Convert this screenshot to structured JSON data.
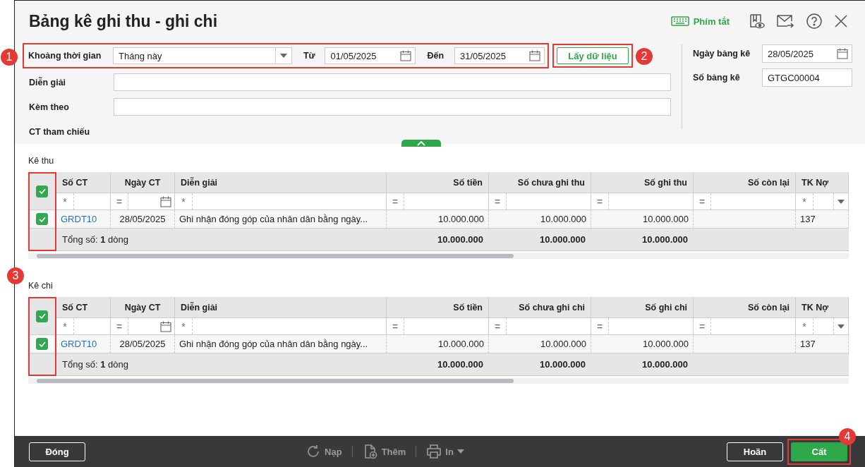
{
  "window": {
    "title": "Bảng kê ghi thu - ghi chi",
    "shortcut": "Phím tắt"
  },
  "filter": {
    "callout": "1",
    "period_label": "Khoảng thời gian",
    "period": "Tháng này",
    "from_label": "Từ",
    "from": "01/05/2025",
    "to_label": "Đến",
    "to": "31/05/2025"
  },
  "fetch_button": {
    "label": "Lấy dữ liệu",
    "callout": "2"
  },
  "fields": [
    {
      "label": "Diễn giải",
      "kind": "input"
    },
    {
      "label": "Kèm theo",
      "kind": "input"
    },
    {
      "label": "CT tham chiếu",
      "kind": "label"
    }
  ],
  "side_fields": [
    {
      "label": "Ngày bảng kê",
      "value": "28/05/2025",
      "kind": "date"
    },
    {
      "label": "Số bảng kê",
      "value": "GTGC00004",
      "kind": "text"
    }
  ],
  "tables_callout": "3",
  "sections": [
    {
      "title": "Kê thu",
      "all_checked": true,
      "columns": [
        {
          "label": "Số CT",
          "kind": "link",
          "op": "*"
        },
        {
          "label": "Ngày CT",
          "kind": "date",
          "op": "="
        },
        {
          "label": "Diễn giải",
          "kind": "text",
          "op": "*"
        },
        {
          "label": "Số tiền",
          "kind": "number",
          "op": "="
        },
        {
          "label": "Số chưa ghi thu",
          "kind": "number",
          "op": "="
        },
        {
          "label": "Số ghi thu",
          "kind": "number",
          "op": "="
        },
        {
          "label": "Số còn lại",
          "kind": "number",
          "op": "="
        },
        {
          "label": "TK Nợ",
          "kind": "account",
          "op": "*"
        }
      ],
      "rows": [
        {
          "checked": true,
          "cells": [
            "GRDT10",
            "28/05/2025",
            "Ghi nhận đóng góp của nhân dân bằng ngày...",
            "10.000.000",
            "10.000.000",
            "10.000.000",
            null,
            "137"
          ]
        }
      ],
      "total_label": "Tổng số: **1** dòng",
      "totals": [
        "10.000.000",
        "10.000.000",
        "10.000.000"
      ]
    },
    {
      "title": "Kê chi",
      "all_checked": true,
      "columns": [
        {
          "label": "Số CT",
          "kind": "link",
          "op": "*"
        },
        {
          "label": "Ngày CT",
          "kind": "date",
          "op": "="
        },
        {
          "label": "Diễn giải",
          "kind": "text",
          "op": "*"
        },
        {
          "label": "Số tiền",
          "kind": "number",
          "op": "="
        },
        {
          "label": "Số chưa ghi chi",
          "kind": "number",
          "op": "="
        },
        {
          "label": "Số ghi chi",
          "kind": "number",
          "op": "="
        },
        {
          "label": "Số còn lại",
          "kind": "number",
          "op": "="
        },
        {
          "label": "TK Nợ",
          "kind": "account",
          "op": "*"
        }
      ],
      "rows": [
        {
          "checked": true,
          "cells": [
            "GRDT10",
            "28/05/2025",
            "Ghi nhận đóng góp của nhân dân bằng ngày...",
            "10.000.000",
            "10.000.000",
            "10.000.000",
            null,
            "137"
          ]
        }
      ],
      "total_label": "Tổng số: **1** dòng",
      "totals": [
        "10.000.000",
        "10.000.000",
        "10.000.000"
      ]
    }
  ],
  "footer": {
    "close": "Đóng",
    "tools": [
      {
        "label": "Nạp",
        "kind": "reload"
      },
      {
        "label": "Thêm",
        "kind": "add"
      },
      {
        "label": "In",
        "kind": "print"
      }
    ],
    "postpone": "Hoãn",
    "save": "Cất",
    "save_callout": "4"
  }
}
